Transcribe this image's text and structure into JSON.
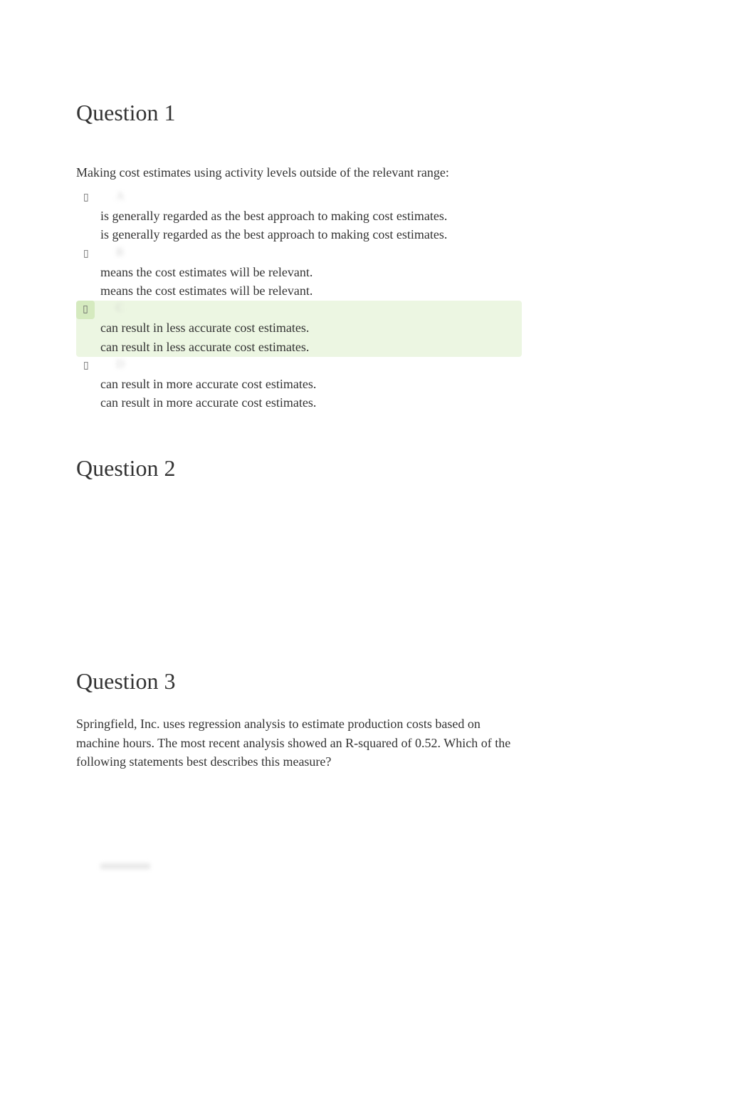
{
  "q1": {
    "title": "Question 1",
    "stem": "Making cost estimates using activity levels outside of the relevant range:",
    "answers": [
      {
        "letter": "A",
        "line1": "is generally regarded as the best approach to making cost estimates.",
        "line2": "is generally regarded as the best approach to making cost estimates.",
        "marker": "▯",
        "correct": false
      },
      {
        "letter": "B",
        "line1": "means the cost estimates will be relevant.",
        "line2": "means the cost estimates will be relevant.",
        "marker": "▯",
        "correct": false
      },
      {
        "letter": "C",
        "line1": "can result in less accurate cost estimates.",
        "line2": "can result in less accurate cost estimates.",
        "marker": "▯",
        "correct": true
      },
      {
        "letter": "D",
        "line1": "can result in more accurate cost estimates.",
        "line2": "can result in more accurate cost estimates.",
        "marker": "▯",
        "correct": false
      }
    ]
  },
  "q2": {
    "title": "Question 2"
  },
  "q3": {
    "title": "Question 3",
    "stem": "Springfield, Inc. uses regression analysis to estimate production costs based on machine hours. The most recent analysis showed an R-squared of 0.52. Which of the following statements best describes this measure?"
  }
}
